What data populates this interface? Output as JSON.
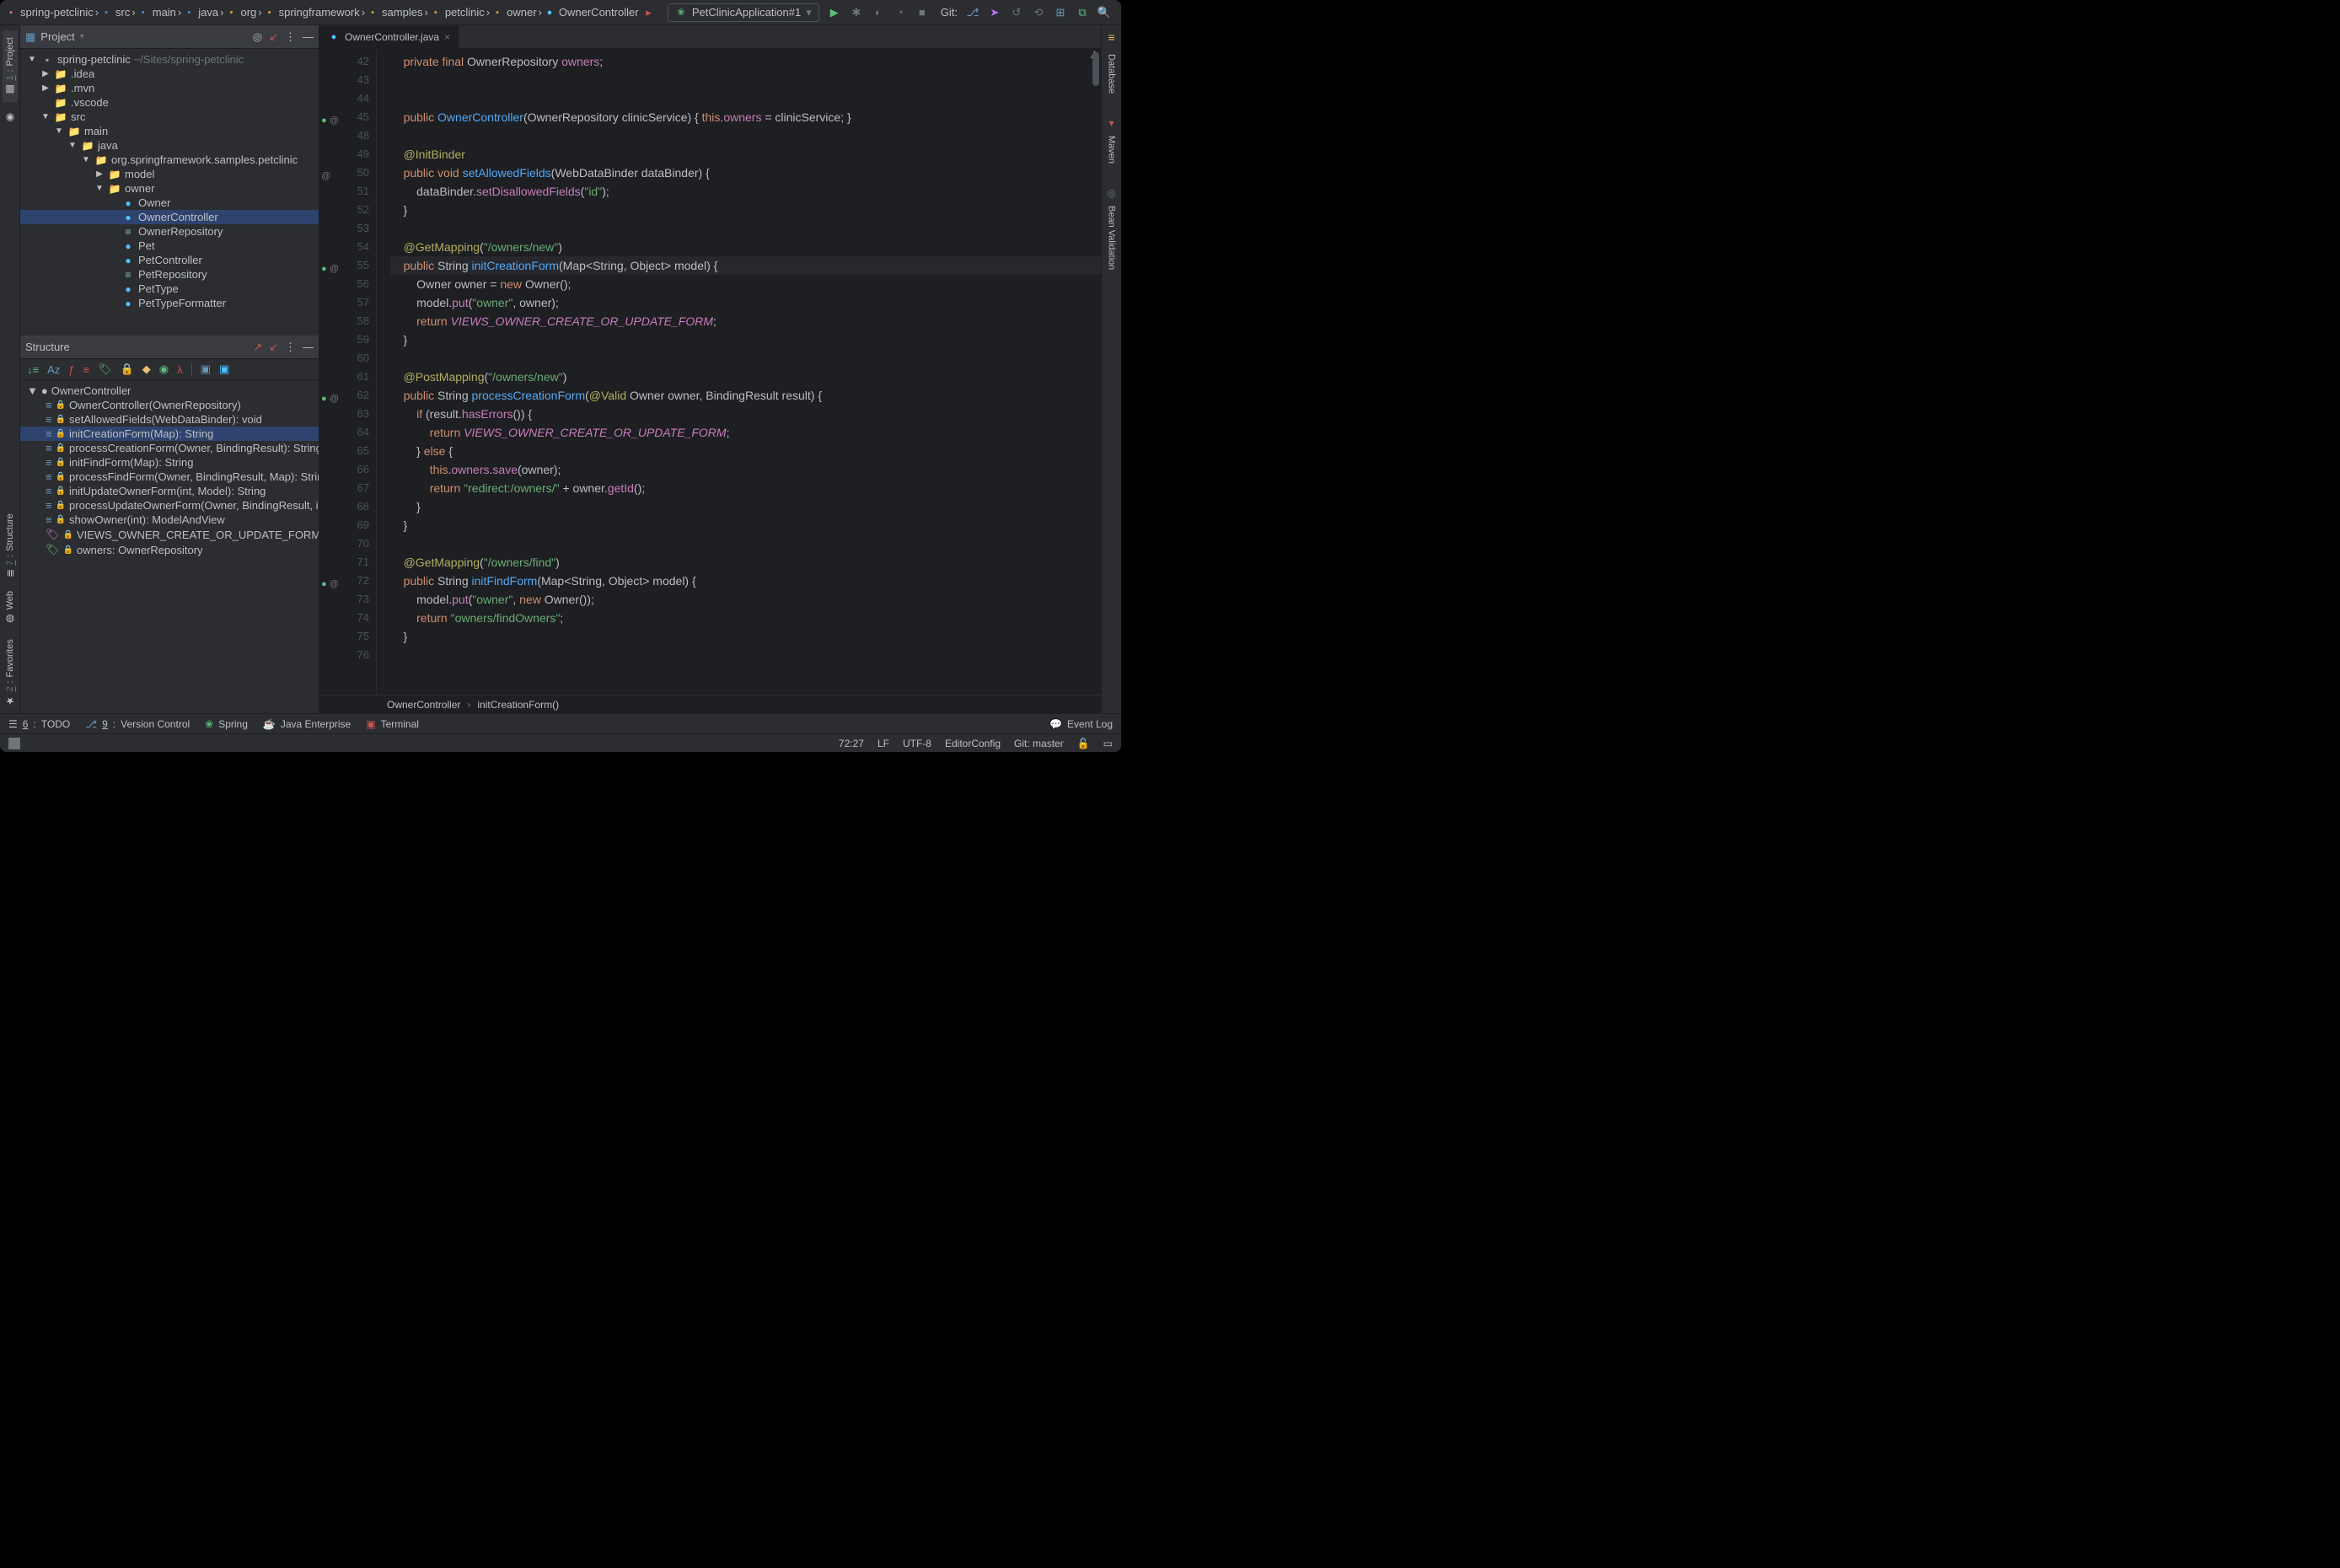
{
  "breadcrumbs": [
    {
      "icon": "pink-folder",
      "label": "spring-petclinic"
    },
    {
      "icon": "blue-folder",
      "label": "src"
    },
    {
      "icon": "blue-folder",
      "label": "main"
    },
    {
      "icon": "blue-folder",
      "label": "java"
    },
    {
      "icon": "yellow-folder",
      "label": "org"
    },
    {
      "icon": "yellow-folder",
      "label": "springframework"
    },
    {
      "icon": "yellow-folder",
      "label": "samples"
    },
    {
      "icon": "yellow-folder",
      "label": "petclinic"
    },
    {
      "icon": "yellow-folder",
      "label": "owner"
    },
    {
      "icon": "class-icon",
      "label": "OwnerController"
    }
  ],
  "run_config": "PetClinicApplication#1",
  "git_label": "Git:",
  "project": {
    "header": "Project",
    "root_name": "spring-petclinic",
    "root_path": "~/Sites/spring-petclinic",
    "tree": [
      {
        "indent": 0,
        "tw": "▼",
        "icon": "pink-folder",
        "label": "spring-petclinic",
        "suffix": "~/Sites/spring-petclinic"
      },
      {
        "indent": 1,
        "tw": "▶",
        "icon": "folder",
        "label": ".idea"
      },
      {
        "indent": 1,
        "tw": "▶",
        "icon": "folder",
        "label": ".mvn"
      },
      {
        "indent": 1,
        "tw": "",
        "icon": "folder-blue",
        "label": ".vscode"
      },
      {
        "indent": 1,
        "tw": "▼",
        "icon": "folder-blue",
        "label": "src"
      },
      {
        "indent": 2,
        "tw": "▼",
        "icon": "folder",
        "label": "main"
      },
      {
        "indent": 3,
        "tw": "▼",
        "icon": "folder-blue",
        "label": "java"
      },
      {
        "indent": 4,
        "tw": "▼",
        "icon": "folder-yellow",
        "label": "org.springframework.samples.petclinic"
      },
      {
        "indent": 5,
        "tw": "▶",
        "icon": "folder-yellow",
        "label": "model"
      },
      {
        "indent": 5,
        "tw": "▼",
        "icon": "folder-yellow",
        "label": "owner"
      },
      {
        "indent": 6,
        "tw": "",
        "icon": "cls",
        "label": "Owner"
      },
      {
        "indent": 6,
        "tw": "",
        "icon": "cls",
        "label": "OwnerController",
        "selected": true
      },
      {
        "indent": 6,
        "tw": "",
        "icon": "iface",
        "label": "OwnerRepository"
      },
      {
        "indent": 6,
        "tw": "",
        "icon": "cls",
        "label": "Pet"
      },
      {
        "indent": 6,
        "tw": "",
        "icon": "cls",
        "label": "PetController"
      },
      {
        "indent": 6,
        "tw": "",
        "icon": "iface",
        "label": "PetRepository"
      },
      {
        "indent": 6,
        "tw": "",
        "icon": "cls",
        "label": "PetType"
      },
      {
        "indent": 6,
        "tw": "",
        "icon": "cls",
        "label": "PetTypeFormatter"
      }
    ]
  },
  "structure": {
    "header": "Structure",
    "class": "OwnerController",
    "items": [
      {
        "label": "OwnerController(OwnerRepository)"
      },
      {
        "label": "setAllowedFields(WebDataBinder): void"
      },
      {
        "label": "initCreationForm(Map<String, Object>): String",
        "selected": true
      },
      {
        "label": "processCreationForm(Owner, BindingResult): String"
      },
      {
        "label": "initFindForm(Map<String, Object>): String"
      },
      {
        "label": "processFindForm(Owner, BindingResult, Map<String, Object>): String"
      },
      {
        "label": "initUpdateOwnerForm(int, Model): String"
      },
      {
        "label": "processUpdateOwnerForm(Owner, BindingResult, int): String"
      },
      {
        "label": "showOwner(int): ModelAndView"
      },
      {
        "label": "VIEWS_OWNER_CREATE_OR_UPDATE_FORM: String",
        "field": true,
        "constant": true
      },
      {
        "label": "owners: OwnerRepository",
        "field": true
      }
    ]
  },
  "editor": {
    "tab": "OwnerController.java",
    "lines": [
      {
        "n": 42,
        "html": "    <span class='c-kw'>private final</span> <span class='c-type'>OwnerRepository</span> <span class='c-field'>owners</span>;"
      },
      {
        "n": 43,
        "html": ""
      },
      {
        "n": 44,
        "html": ""
      },
      {
        "n": 45,
        "mark": "ov-at",
        "html": "    <span class='c-kw'>public</span> <span class='c-meDecl'>OwnerController</span>(<span class='c-type'>OwnerRepository</span> clinicService) { <span class='c-this'>this</span>.<span class='c-field'>owners</span> = clinicService; }"
      },
      {
        "n": 48,
        "html": ""
      },
      {
        "n": 49,
        "html": "    <span class='c-anno'>@InitBinder</span>"
      },
      {
        "n": 50,
        "mark": "at",
        "html": "    <span class='c-kw'>public void</span> <span class='c-meDecl'>setAllowedFields</span>(<span class='c-type'>WebDataBinder</span> dataBinder) {"
      },
      {
        "n": 51,
        "html": "        dataBinder.<span class='c-me'>setDisallowedFields</span>(<span class='c-str'>\"id\"</span>);"
      },
      {
        "n": 52,
        "html": "    }"
      },
      {
        "n": 53,
        "html": ""
      },
      {
        "n": 54,
        "html": "    <span class='c-anno'>@GetMapping</span>(<span class='c-str'>\"/owners/new\"</span>)"
      },
      {
        "n": 55,
        "mark": "ov-at",
        "hl": true,
        "html": "    <span class='c-kw'>public</span> <span class='c-type'>String</span> <span class='c-meDecl'>initCreationForm</span>(<span class='c-type'>Map</span>&lt;<span class='c-type'>String</span>, <span class='c-type'>Object</span>&gt; model) {"
      },
      {
        "n": 56,
        "html": "        <span class='c-type'>Owner</span> owner = <span class='c-kw'>new</span> <span class='c-type'>Owner</span>();"
      },
      {
        "n": 57,
        "html": "        model.<span class='c-me'>put</span>(<span class='c-str'>\"owner\"</span>, owner);"
      },
      {
        "n": 58,
        "html": "        <span class='c-kw'>return</span> <span class='c-const'>VIEWS_OWNER_CREATE_OR_UPDATE_FORM</span>;"
      },
      {
        "n": 59,
        "html": "    }"
      },
      {
        "n": 60,
        "html": ""
      },
      {
        "n": 61,
        "html": "    <span class='c-anno'>@PostMapping</span>(<span class='c-str'>\"/owners/new\"</span>)"
      },
      {
        "n": 62,
        "mark": "ov-at",
        "html": "    <span class='c-kw'>public</span> <span class='c-type'>String</span> <span class='c-meDecl'>processCreationForm</span>(<span class='c-anno'>@Valid</span> <span class='c-type'>Owner</span> owner, <span class='c-type'>BindingResult</span> result) {"
      },
      {
        "n": 63,
        "html": "        <span class='c-kw'>if</span> (result.<span class='c-me'>hasErrors</span>()) {"
      },
      {
        "n": 64,
        "html": "            <span class='c-kw'>return</span> <span class='c-const'>VIEWS_OWNER_CREATE_OR_UPDATE_FORM</span>;"
      },
      {
        "n": 65,
        "html": "        } <span class='c-kw'>else</span> {"
      },
      {
        "n": 66,
        "html": "            <span class='c-this'>this</span>.<span class='c-field'>owners</span>.<span class='c-me'>save</span>(owner);"
      },
      {
        "n": 67,
        "html": "            <span class='c-kw'>return</span> <span class='c-str'>\"redirect:/owners/\"</span> + owner.<span class='c-me'>getId</span>();"
      },
      {
        "n": 68,
        "html": "        }"
      },
      {
        "n": 69,
        "html": "    }"
      },
      {
        "n": 70,
        "html": ""
      },
      {
        "n": 71,
        "html": "    <span class='c-anno'>@GetMapping</span>(<span class='c-str'>\"/owners/find\"</span>)"
      },
      {
        "n": 72,
        "mark": "ov-at",
        "html": "    <span class='c-kw'>public</span> <span class='c-type'>String</span> <span class='c-meDecl'>initFindForm</span>(<span class='c-type'>Map</span>&lt;<span class='c-type'>String</span>, <span class='c-type'>Object</span>&gt; model) {"
      },
      {
        "n": 73,
        "html": "        model.<span class='c-me'>put</span>(<span class='c-str'>\"owner\"</span>, <span class='c-kw'>new</span> <span class='c-type'>Owner</span>());"
      },
      {
        "n": 74,
        "html": "        <span class='c-kw'>return</span> <span class='c-str'>\"owners/findOwners\"</span>;"
      },
      {
        "n": 75,
        "html": "    }"
      },
      {
        "n": 76,
        "html": ""
      }
    ],
    "breadcrumb": [
      "OwnerController",
      "initCreationForm()"
    ]
  },
  "left_stripe": [
    {
      "num": "1",
      "label": "Project",
      "active": true,
      "icon": "▦"
    },
    {
      "num": "",
      "label": "",
      "icon": "◉"
    }
  ],
  "left_stripe_bottom": [
    {
      "num": "7",
      "label": "Structure",
      "icon": "≣"
    },
    {
      "num": "",
      "label": "Web",
      "icon": "◍"
    },
    {
      "num": "2",
      "label": "Favorites",
      "icon": "★"
    }
  ],
  "right_stripe": [
    {
      "label": "Database",
      "icon": "db"
    },
    {
      "label": "Maven",
      "icon": "mvn"
    },
    {
      "label": "Bean Validation",
      "icon": "bv"
    }
  ],
  "bottom": [
    {
      "icon": "☰",
      "under": "6",
      "label": "TODO"
    },
    {
      "icon": "⎇",
      "under": "9",
      "label": "Version Control",
      "iconColor": "#6897bb"
    },
    {
      "icon": "❀",
      "label": "Spring",
      "iconColor": "#5eba7d"
    },
    {
      "icon": "☕",
      "label": "Java Enterprise"
    },
    {
      "icon": "▣",
      "label": "Terminal",
      "iconColor": "#c75450"
    }
  ],
  "event_log": "Event Log",
  "status": {
    "pos": "72:27",
    "eol": "LF",
    "enc": "UTF-8",
    "cfg": "EditorConfig",
    "git": "Git: master"
  }
}
